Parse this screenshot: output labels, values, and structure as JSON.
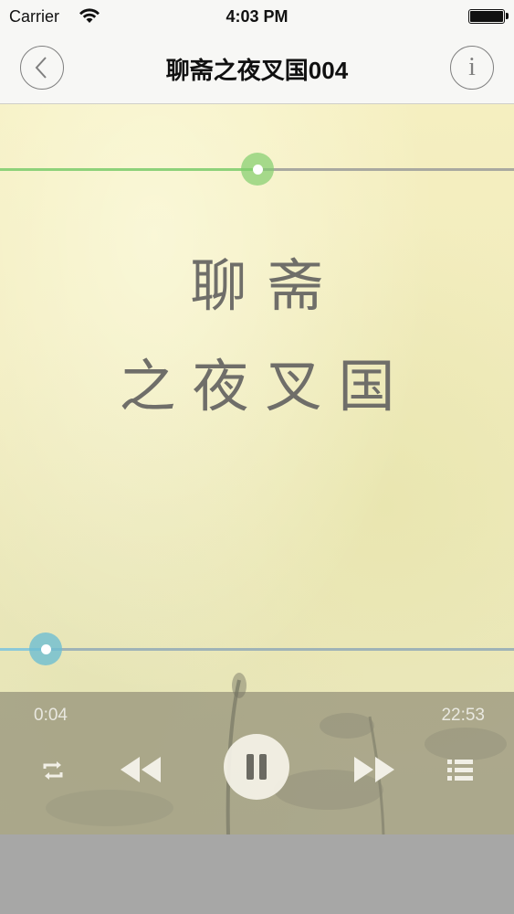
{
  "status_bar": {
    "carrier": "Carrier",
    "time": "4:03 PM"
  },
  "nav": {
    "title": "聊斋之夜叉国004",
    "back_icon": "back-chevron-icon",
    "info_icon": "info-icon",
    "info_label": "i"
  },
  "artwork": {
    "title_line1": "聊斋",
    "title_line2": "之夜叉国"
  },
  "top_slider": {
    "value": 0.5,
    "color": "#8ed27a"
  },
  "progress": {
    "elapsed": "0:04",
    "total": "22:53",
    "value": 0.003,
    "color": "#8cc9d8"
  },
  "controls": {
    "repeat_icon": "repeat-icon",
    "rewind_icon": "rewind-icon",
    "pause_icon": "pause-icon",
    "forward_icon": "fast-forward-icon",
    "playlist_icon": "playlist-icon"
  }
}
